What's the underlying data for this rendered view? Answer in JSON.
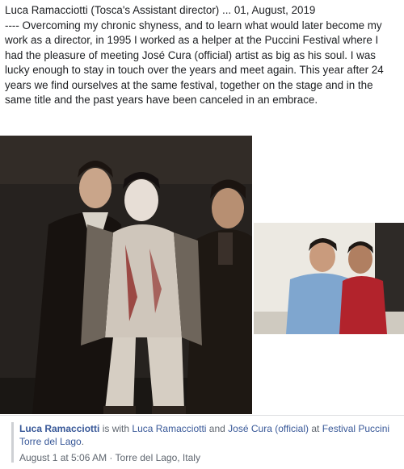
{
  "post": {
    "header": "Luca Ramacciotti (Tosca's Assistant director) ... 01, August, 2019",
    "body": "---- Overcoming my chronic shyness, and to learn what would later become my work as a director, in 1995 I worked as a helper at the Puccini Festival where I had the pleasure of meeting José Cura (official) artist as big as his soul. I was lucky enough to stay in touch over the years and meet again. This year after 24 years we find ourselves at the same festival, together on the stage and in the same title and the past years have been canceled in an embrace."
  },
  "tagging": {
    "author": "Luca Ramacciotti",
    "is_with": "is with",
    "tagged_1": "Luca Ramacciotti",
    "and": "and",
    "tagged_2": "José Cura (official)",
    "at": "at",
    "place": "Festival Puccini Torre del Lago",
    "period": ".",
    "date": "August 1 at 5:06 AM",
    "separator": "·",
    "location": "Torre del Lago, Italy"
  },
  "colors": {
    "link": "#385898",
    "meta": "#606770",
    "text": "#1c1e21"
  }
}
